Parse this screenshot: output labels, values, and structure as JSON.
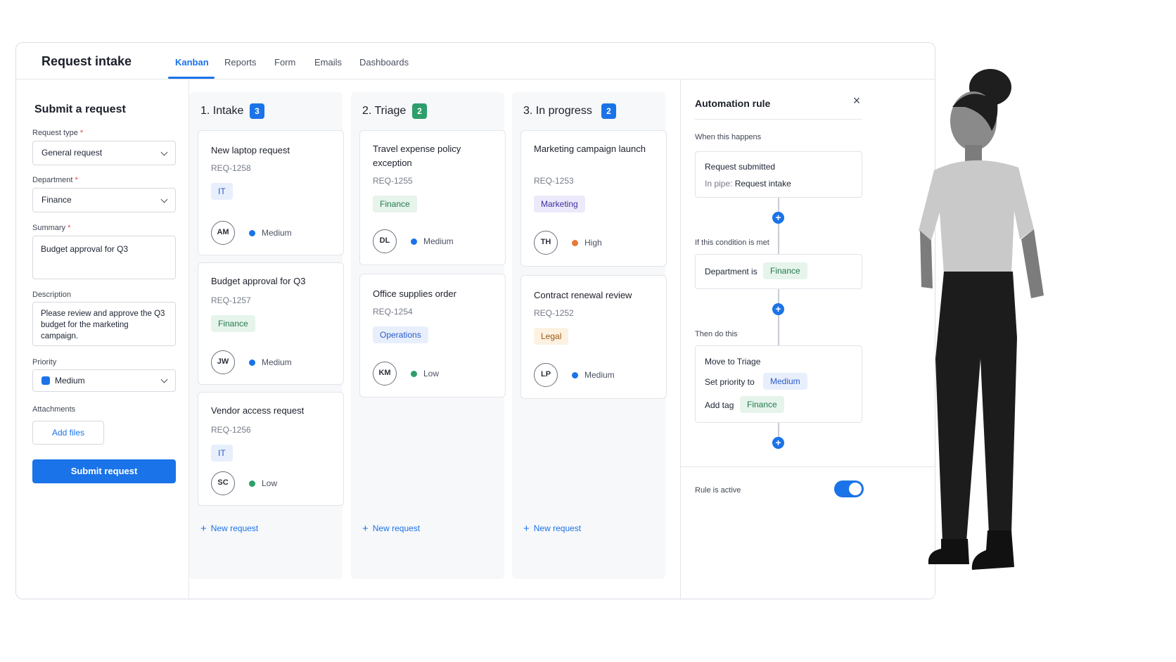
{
  "app": {
    "title": "Request intake",
    "tabs": [
      "Kanban",
      "Reports",
      "Form",
      "Emails",
      "Dashboards"
    ],
    "active_tab": "Kanban"
  },
  "form": {
    "title": "Submit a request",
    "request_type": {
      "label": "Request type",
      "required": "*",
      "value": "General request"
    },
    "department": {
      "label": "Department",
      "required": "*",
      "value": "Finance"
    },
    "summary": {
      "label": "Summary",
      "required": "*",
      "value": "Budget approval for Q3"
    },
    "description": {
      "label": "Description",
      "value": "Please review and approve the Q3 budget for the marketing campaign."
    },
    "priority": {
      "label": "Priority",
      "value": "Medium",
      "color": "#1a73e8"
    },
    "attachments": {
      "label": "Attachments",
      "button": "Add files"
    },
    "submit": "Submit request"
  },
  "columns": [
    {
      "title": "1. Intake",
      "count": "3",
      "count_color": "#1a73e8",
      "new_label": "New request",
      "cards": [
        {
          "title": "New laptop request",
          "id": "REQ-1258",
          "tag": "IT",
          "assignee": "AM",
          "priority": "Medium",
          "priority_color": "#1a73e8"
        },
        {
          "title": "Budget approval for Q3",
          "id": "REQ-1257",
          "tag": "Finance",
          "assignee": "JW",
          "priority": "Medium",
          "priority_color": "#1a73e8"
        },
        {
          "title": "Vendor access request",
          "id": "REQ-1256",
          "tag": "IT",
          "assignee": "SC",
          "priority": "Low",
          "priority_color": "#2e9e6a"
        }
      ]
    },
    {
      "title": "2. Triage",
      "count": "2",
      "count_color": "#2e9e6a",
      "new_label": "New request",
      "cards": [
        {
          "title": "Travel expense policy exception",
          "id": "REQ-1255",
          "tag": "Finance",
          "assignee": "DL",
          "priority": "Medium",
          "priority_color": "#1a73e8"
        },
        {
          "title": "Office supplies order",
          "id": "REQ-1254",
          "tag": "Operations",
          "assignee": "KM",
          "priority": "Low",
          "priority_color": "#2e9e6a"
        }
      ]
    },
    {
      "title": "3. In progress",
      "count": "2",
      "count_color": "#1a73e8",
      "new_label": "New request",
      "cards": [
        {
          "title": "Marketing campaign launch",
          "id": "REQ-1253",
          "tag": "Marketing",
          "assignee": "TH",
          "priority": "High",
          "priority_color": "#e8783a"
        },
        {
          "title": "Contract renewal review",
          "id": "REQ-1252",
          "tag": "Legal",
          "assignee": "LP",
          "priority": "Medium",
          "priority_color": "#1a73e8"
        }
      ]
    }
  ],
  "tag_colors": {
    "IT": {
      "bg": "#e8effc",
      "fg": "#2a5bc7"
    },
    "Finance": {
      "bg": "#e6f4ec",
      "fg": "#237a4c"
    },
    "Operations": {
      "bg": "#e8effc",
      "fg": "#2a5bc7"
    },
    "Marketing": {
      "bg": "#ece9fb",
      "fg": "#3d2fa0"
    },
    "Legal": {
      "bg": "#fdf1e1",
      "fg": "#9a5a12"
    }
  },
  "automation": {
    "title": "Automation rule",
    "when_label": "When this happens",
    "trigger": "Request submitted",
    "trigger_sub_prefix": "In pipe:",
    "trigger_sub_value": "Request intake",
    "condition_label": "If this condition is met",
    "condition_text": "Department is",
    "condition_tag": "Finance",
    "then_label": "Then do this",
    "action_move": "Move to Triage",
    "action_priority_label": "Set priority to",
    "action_priority_value": "Medium",
    "action_tag_label": "Add tag",
    "action_tag_value": "Finance",
    "active_label": "Rule is active",
    "active": true
  }
}
